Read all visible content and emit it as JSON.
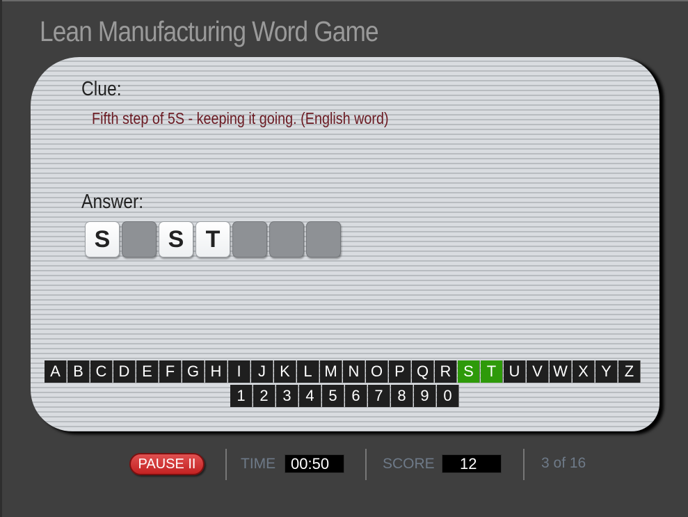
{
  "title": "Lean Manufacturing Word Game",
  "clue": {
    "label": "Clue:",
    "text": "Fifth step of 5S - keeping it going. (English word)"
  },
  "answer": {
    "label": "Answer:",
    "tiles": [
      "S",
      "",
      "S",
      "T",
      "",
      "",
      ""
    ]
  },
  "keyboard": {
    "letters": [
      "A",
      "B",
      "C",
      "D",
      "E",
      "F",
      "G",
      "H",
      "I",
      "J",
      "K",
      "L",
      "M",
      "N",
      "O",
      "P",
      "Q",
      "R",
      "S",
      "T",
      "U",
      "V",
      "W",
      "X",
      "Y",
      "Z"
    ],
    "digits": [
      "1",
      "2",
      "3",
      "4",
      "5",
      "6",
      "7",
      "8",
      "9",
      "0"
    ],
    "used": [
      "S",
      "T"
    ],
    "used_color": "#2e9a0a"
  },
  "status": {
    "pause_label": "PAUSE II",
    "time_label": "TIME",
    "time_value": "00:50",
    "score_label": "SCORE",
    "score_value": "12",
    "progress": "3 of 16"
  }
}
